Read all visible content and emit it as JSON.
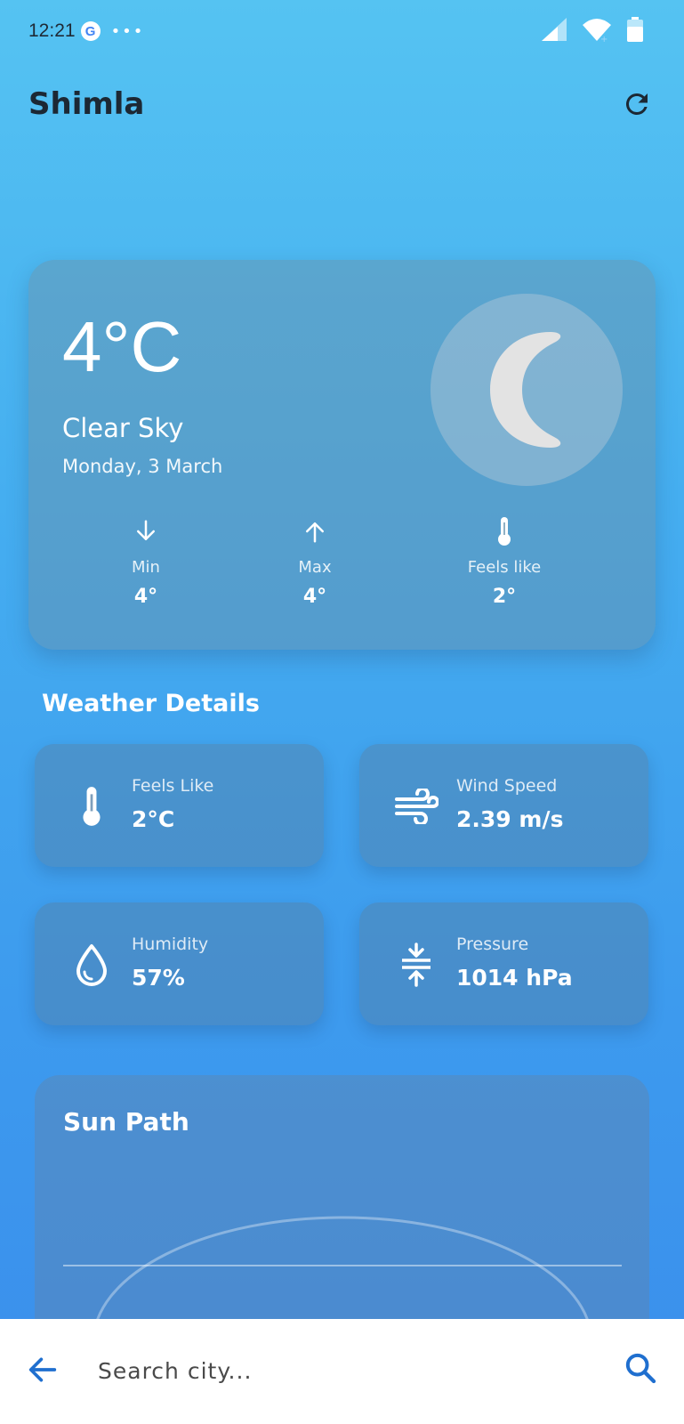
{
  "status": {
    "time": "12:21",
    "google_letter": "G",
    "more": "•••"
  },
  "header": {
    "city": "Shimla"
  },
  "current": {
    "temperature": "4°C",
    "condition": "Clear Sky",
    "date": "Monday, 3 March",
    "icon": "moon-icon"
  },
  "stats": [
    {
      "label": "Min",
      "value": "4°",
      "icon": "arrow-down-icon"
    },
    {
      "label": "Max",
      "value": "4°",
      "icon": "arrow-up-icon"
    },
    {
      "label": "Feels like",
      "value": "2°",
      "icon": "thermometer-icon"
    }
  ],
  "details": {
    "title": "Weather Details",
    "items": [
      {
        "label": "Feels Like",
        "value": "2°C",
        "icon": "thermometer-icon"
      },
      {
        "label": "Wind Speed",
        "value": "2.39 m/s",
        "icon": "wind-icon"
      },
      {
        "label": "Humidity",
        "value": "57%",
        "icon": "water-drop-icon"
      },
      {
        "label": "Pressure",
        "value": "1014 hPa",
        "icon": "compress-icon"
      }
    ]
  },
  "sun_path": {
    "title": "Sun Path"
  },
  "search": {
    "placeholder": "Search city..."
  },
  "colors": {
    "accent": "#1f6fcf",
    "title_text": "#1c2834"
  }
}
